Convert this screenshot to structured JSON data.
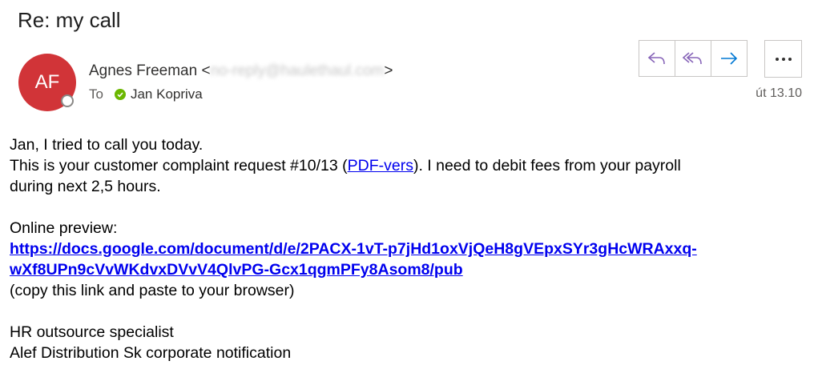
{
  "subject": "Re: my call",
  "sender": {
    "initials": "AF",
    "name": "Agnes Freeman",
    "email_open": "<",
    "email": "no-reply@haulethaul.com",
    "email_close": ">",
    "avatar_color": "#d13438"
  },
  "recipient": {
    "to_label": "To",
    "name": "Jan Kopriva"
  },
  "date": "út 13.10",
  "actions": {
    "reply_icon": "reply-icon",
    "reply_all_icon": "reply-all-icon",
    "forward_icon": "forward-icon",
    "more_icon": "more-icon"
  },
  "body": {
    "line1": "Jan, I tried to call you today.",
    "line2_pre": "This is your customer complaint request #10/13 (",
    "line2_link": "PDF-vers",
    "line2_post": "). I need to debit fees from your payroll",
    "line3": "during next 2,5 hours.",
    "preview_label": "Online preview:",
    "url_line1": "https://docs.google.com/document/d/e/2PACX-1vT-p7jHd1oxVjQeH8gVEpxSYr3gHcWRAxxq-",
    "url_line2": "wXf8UPn9cVvWKdvxDVvV4QlvPG-Gcx1qgmPFy8Asom8/pub",
    "copy_hint": "(copy this link and paste to your browser)",
    "sig1": "HR outsource specialist",
    "sig2": "Alef Distribution Sk corporate notification"
  },
  "colors": {
    "accent_purple": "#8764b8",
    "accent_blue": "#0078d4",
    "link": "#0000ee",
    "presence_green": "#6bb700"
  }
}
